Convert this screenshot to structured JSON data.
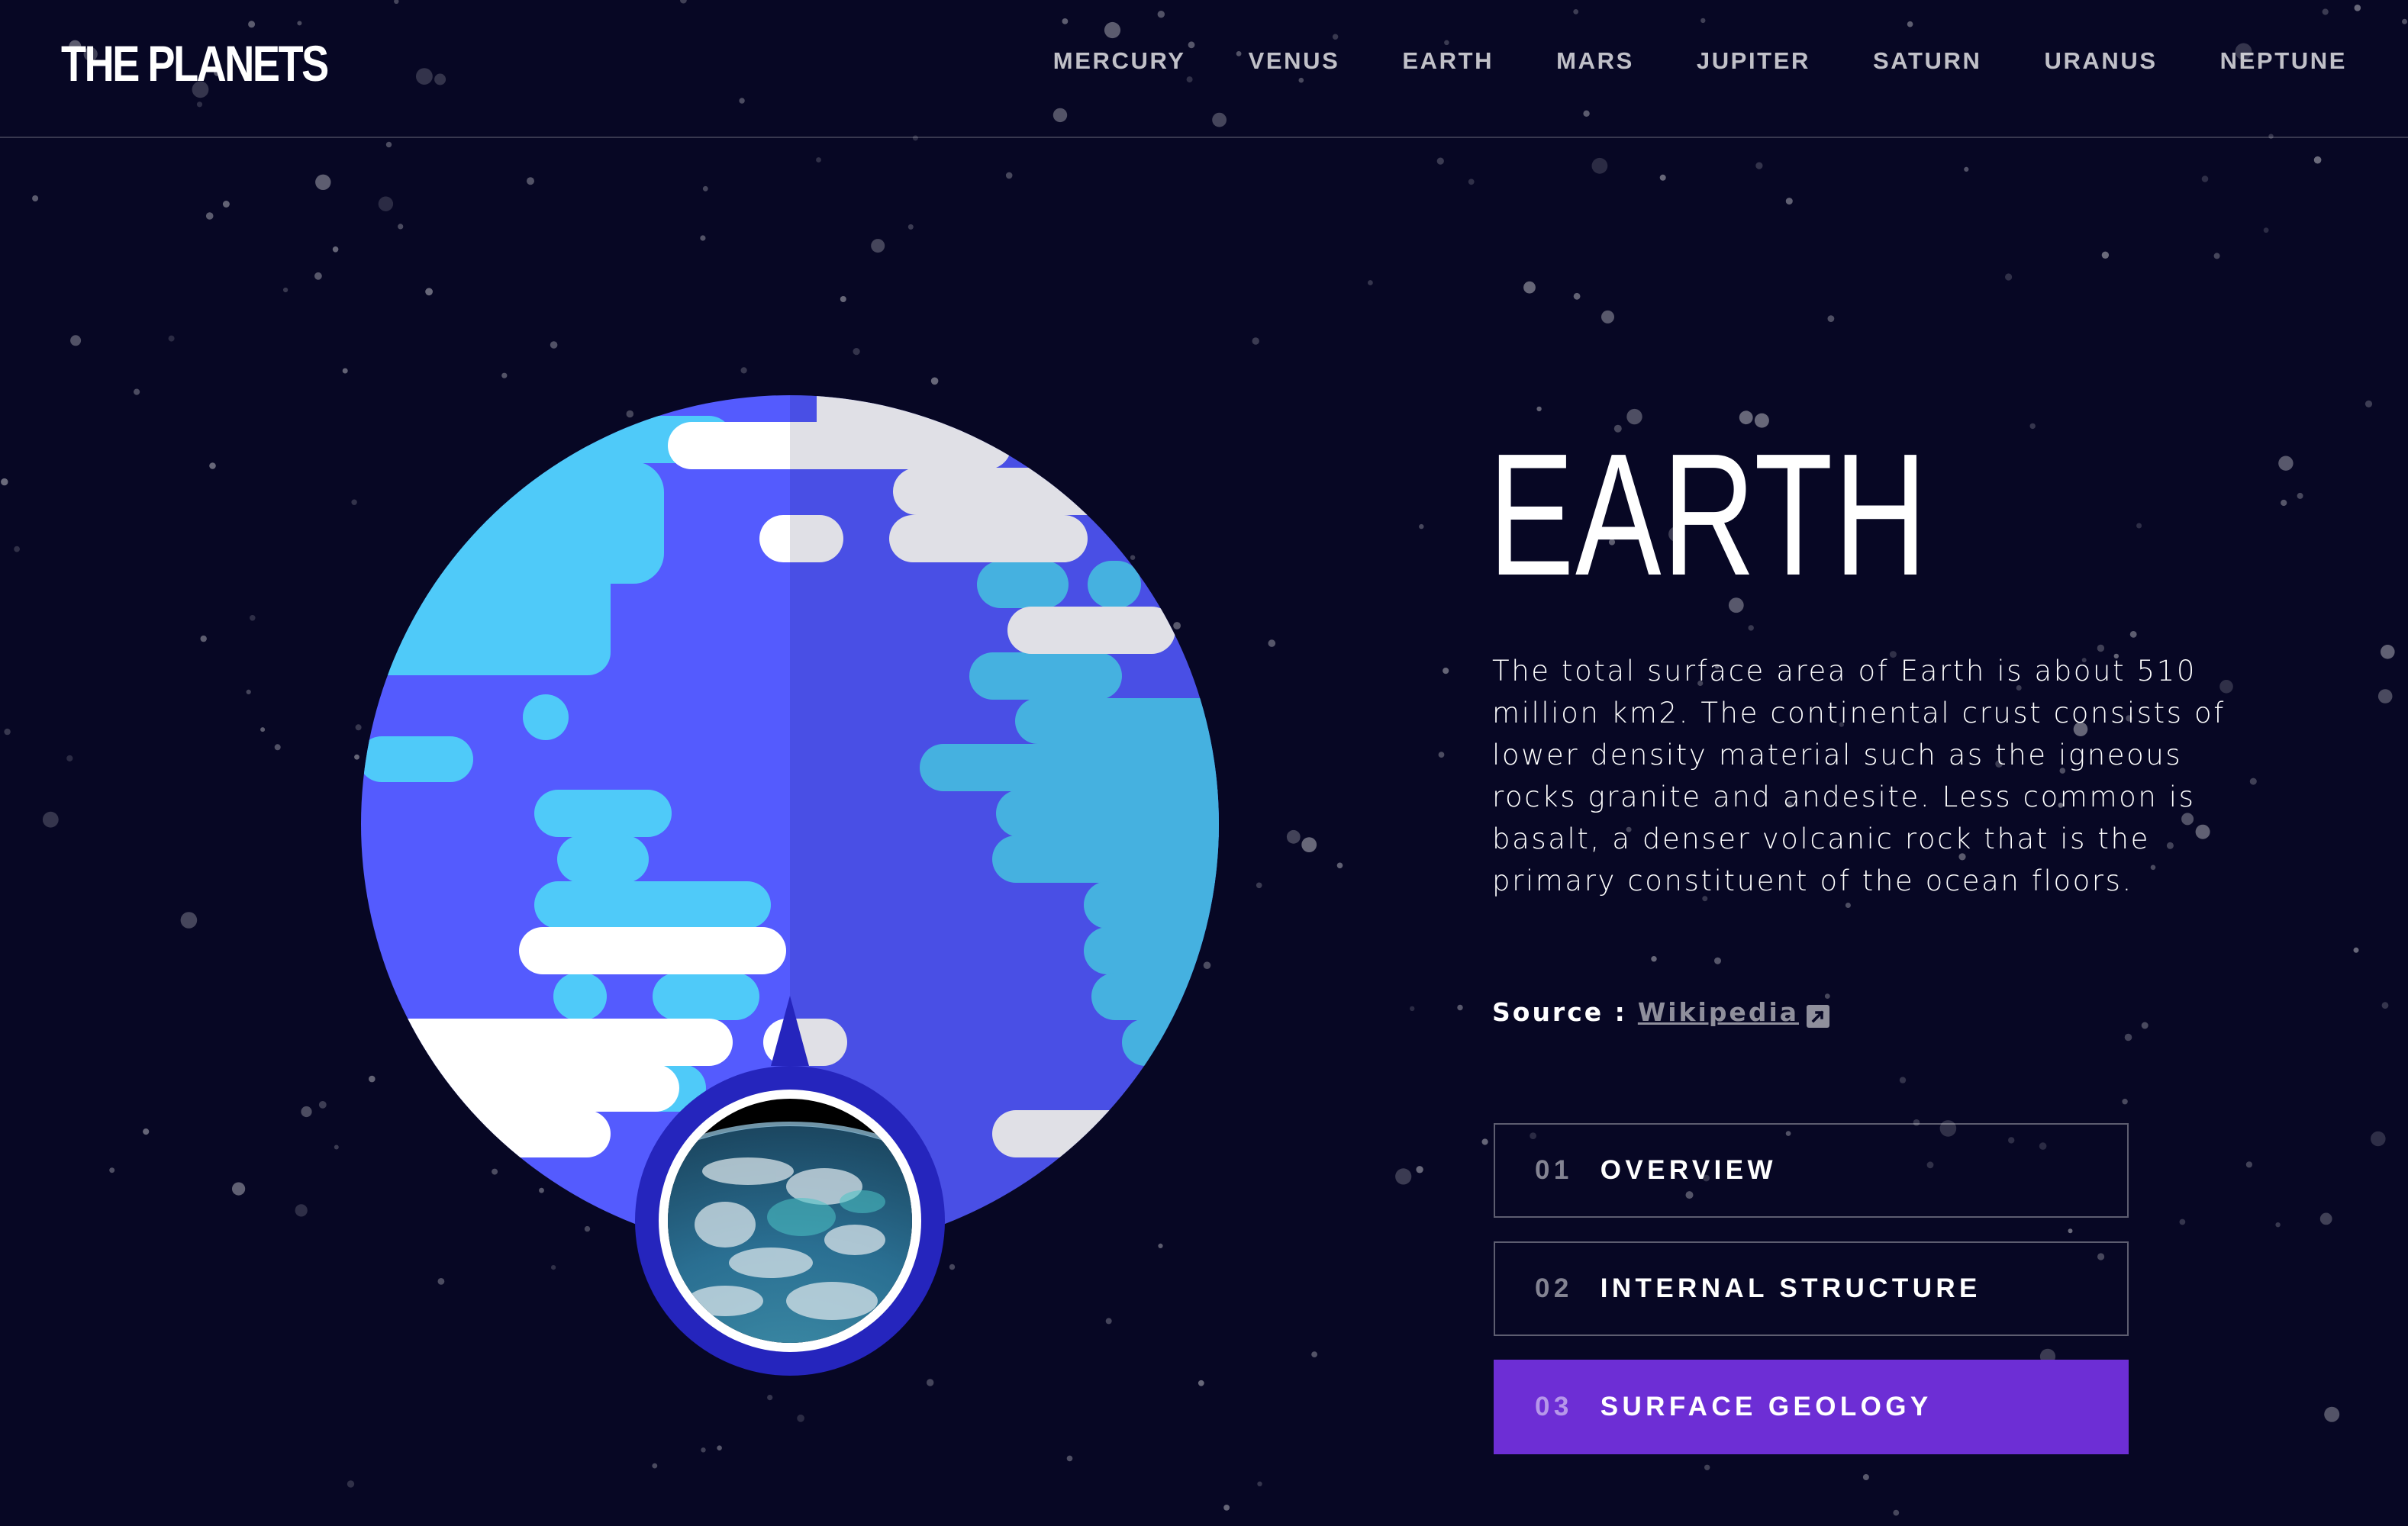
{
  "header": {
    "logo": "THE PLANETS",
    "nav": [
      "MERCURY",
      "VENUS",
      "EARTH",
      "MARS",
      "JUPITER",
      "SATURN",
      "URANUS",
      "NEPTUNE"
    ]
  },
  "planet": {
    "name": "EARTH",
    "description": "The total surface area of Earth is about 510 million km2. The continental crust consists of lower density material such as the igneous rocks granite and andesite. Less common is basalt, a denser volcanic rock that is the primary constituent of the ocean floors.",
    "source_label": "Source :",
    "source_link": "Wikipedia",
    "source_icon": "external-link-icon"
  },
  "tabs": [
    {
      "num": "01",
      "label": "OVERVIEW",
      "active": false
    },
    {
      "num": "02",
      "label": "INTERNAL STRUCTURE",
      "active": false
    },
    {
      "num": "03",
      "label": "SURFACE GEOLOGY",
      "active": true
    }
  ],
  "colors": {
    "background": "#070724",
    "accent": "#6D2ED5",
    "ocean": "#545BFE",
    "land": "#4FCAF9",
    "cloud": "#FFFFFF"
  }
}
